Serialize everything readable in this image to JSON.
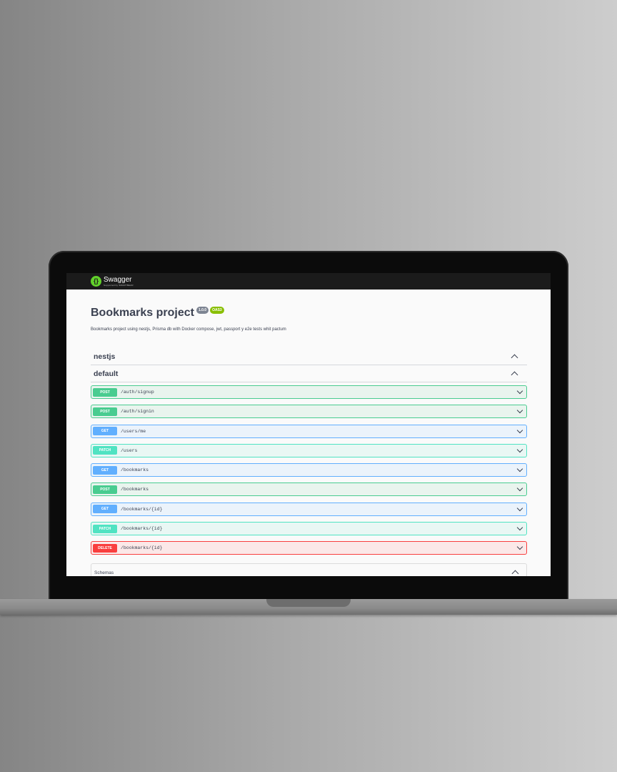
{
  "topbar": {
    "logo_text": "Swagger",
    "logo_sub": "Supported by SMARTBEAR"
  },
  "info": {
    "title": "Bookmarks project",
    "version": "1.0.0",
    "oas": "OAS3",
    "description": "Bookmarks project using nestjs, Prisma db with Docker compose, jwt, passport y e2e tests whit pactum"
  },
  "tags": [
    {
      "name": "nestjs"
    },
    {
      "name": "default"
    }
  ],
  "operations": [
    {
      "method": "POST",
      "path": "/auth/signup"
    },
    {
      "method": "POST",
      "path": "/auth/signin"
    },
    {
      "method": "GET",
      "path": "/users/me"
    },
    {
      "method": "PATCH",
      "path": "/users"
    },
    {
      "method": "GET",
      "path": "/bookmarks"
    },
    {
      "method": "POST",
      "path": "/bookmarks"
    },
    {
      "method": "GET",
      "path": "/bookmarks/{id}"
    },
    {
      "method": "PATCH",
      "path": "/bookmarks/{id}"
    },
    {
      "method": "DELETE",
      "path": "/bookmarks/{id}"
    }
  ],
  "schemas": {
    "label": "Schemas"
  },
  "colors": {
    "post": "#49cc90",
    "get": "#61affe",
    "patch": "#50e3c2",
    "delete": "#f93e3e",
    "logo": "#62d12b"
  }
}
